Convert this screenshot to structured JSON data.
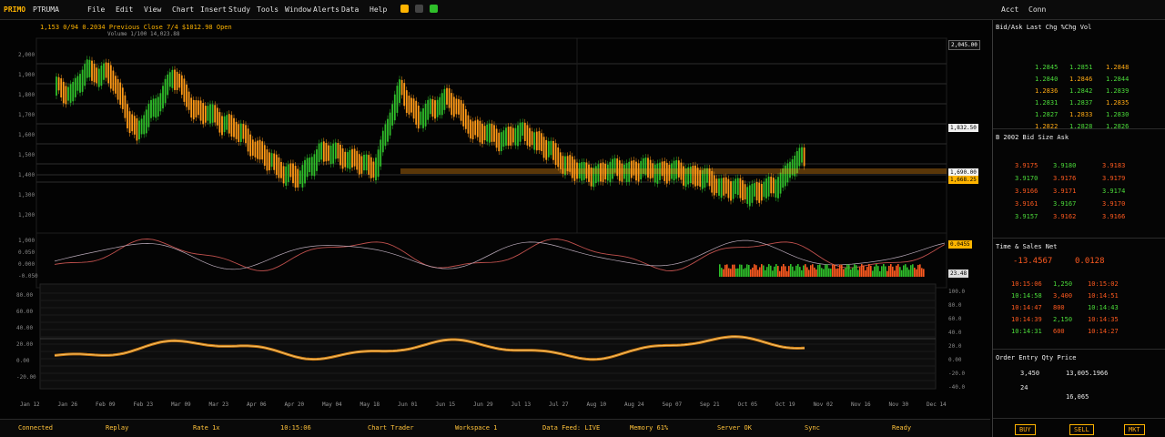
{
  "menubar": {
    "logo": "PRIMO",
    "ticker": "PTRUMA",
    "items": [
      "File",
      "Edit",
      "View",
      "Chart",
      "Insert",
      "Study",
      "Tools",
      "Window",
      "Alerts",
      "Data",
      "Help"
    ],
    "center_title": "",
    "right_items": [
      "Acct",
      "Conn"
    ]
  },
  "chart": {
    "header_line_1": "1,153 0/94   0.2034   Previous Close 7/4  $1012.98 Open",
    "header_line_2": "Volume 1/100 14,023.88",
    "main_price_ticks": [
      "2,000",
      "1,900",
      "1,800",
      "1,700",
      "1,600",
      "1,500",
      "1,400",
      "1,300",
      "1,200"
    ],
    "indicator_ticks": [
      "1,000",
      "0.050",
      "0.000",
      "-0.050"
    ],
    "lower_ticks": [
      "80.00",
      "60.00",
      "40.00",
      "20.00",
      "0.00",
      "-20.00"
    ],
    "lower_right_ticks": [
      "100.0",
      "80.0",
      "60.0",
      "40.0",
      "20.0",
      "0.00",
      "-20.0",
      "-40.0"
    ],
    "tags": {
      "tag1": "2,045.00",
      "tag2": "1,832.50",
      "tag3": "1,690.00",
      "tag4": "1,668.25",
      "tag5": "0.0455",
      "tag6": "23.48"
    },
    "time_axis": [
      "Jan 12",
      "Jan 26",
      "Feb 09",
      "Feb 23",
      "Mar 09",
      "Mar 23",
      "Apr 06",
      "Apr 20",
      "May 04",
      "May 18",
      "Jun 01",
      "Jun 15",
      "Jun 29",
      "Jul 13",
      "Jul 27",
      "Aug 10",
      "Aug 24",
      "Sep 07",
      "Sep 21",
      "Oct 05",
      "Oct 19",
      "Nov 02",
      "Nov 16",
      "Nov 30",
      "Dec 14"
    ]
  },
  "sidepanel": {
    "panel1": {
      "header": "Bid/Ask   Last   Chg   %Chg   Vol",
      "rows": [
        [
          "1.2845",
          "1.2851",
          "1.2848"
        ],
        [
          "1.2840",
          "1.2846",
          "1.2844"
        ],
        [
          "1.2836",
          "1.2842",
          "1.2839"
        ],
        [
          "1.2831",
          "1.2837",
          "1.2835"
        ],
        [
          "1.2827",
          "1.2833",
          "1.2830"
        ],
        [
          "1.2822",
          "1.2828",
          "1.2826"
        ]
      ]
    },
    "panel2": {
      "header": "B 2002   Bid   Size   Ask",
      "rows": [
        [
          "3.9175",
          "3.9180",
          "3.9183"
        ],
        [
          "3.9170",
          "3.9176",
          "3.9179"
        ],
        [
          "3.9166",
          "3.9171",
          "3.9174"
        ],
        [
          "3.9161",
          "3.9167",
          "3.9170"
        ],
        [
          "3.9157",
          "3.9162",
          "3.9166"
        ]
      ]
    },
    "panel3": {
      "header": "Time & Sales    Net",
      "big_left": "-13.4567",
      "big_right": "0.0128",
      "rows": [
        [
          "10:15:06",
          "1,250",
          "10:15:02"
        ],
        [
          "10:14:58",
          "3,400",
          "10:14:51"
        ],
        [
          "10:14:47",
          "800",
          "10:14:43"
        ],
        [
          "10:14:39",
          "2,150",
          "10:14:35"
        ],
        [
          "10:14:31",
          "600",
          "10:14:27"
        ]
      ]
    },
    "panel4": {
      "header": "Order Entry   Qty   Price",
      "qty": "3,450",
      "price": "13,005.1966",
      "line2": "24",
      "line3": "16,065"
    },
    "footer": [
      "BUY",
      "SELL",
      "MKT"
    ]
  },
  "status": {
    "items": [
      "Connected",
      "Replay",
      "Rate 1x",
      "10:15:06",
      "Chart Trader",
      "Workspace 1",
      "Data Feed: LIVE",
      "Memory 61%",
      "Server OK",
      "Sync",
      "Ready"
    ]
  },
  "colors": {
    "up": "#2fbf2a",
    "down": "#ff9a17",
    "accent": "#ffb400",
    "bg": "#030303"
  }
}
